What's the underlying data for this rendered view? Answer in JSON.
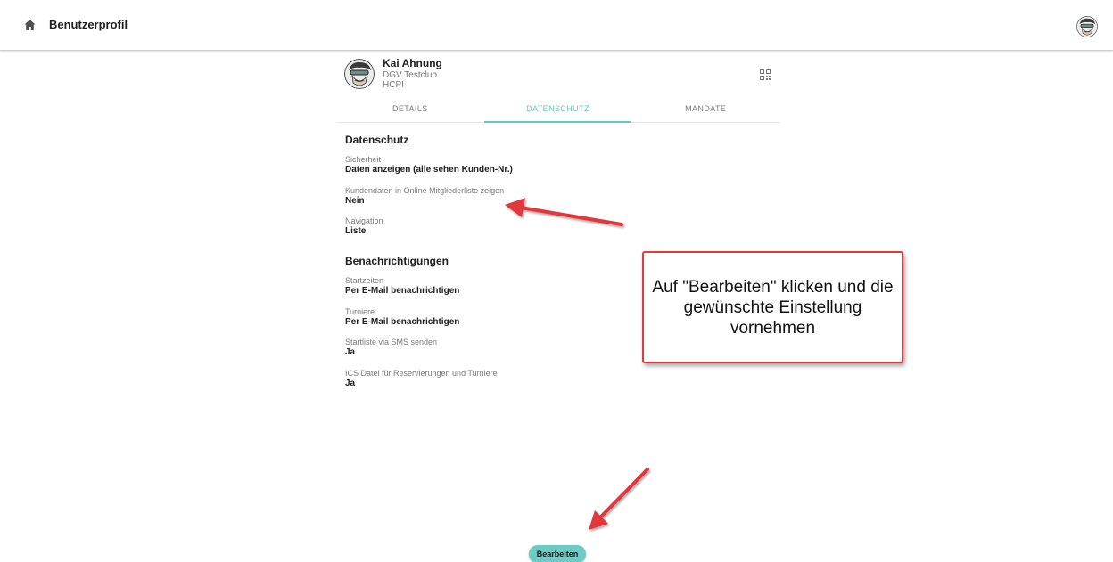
{
  "header": {
    "title": "Benutzerprofil"
  },
  "profile": {
    "name": "Kai Ahnung",
    "club": "DGV Testclub",
    "hcpi": "HCPI"
  },
  "tabs": [
    {
      "label": "DETAILS",
      "active": false
    },
    {
      "label": "DATENSCHUTZ",
      "active": true
    },
    {
      "label": "MANDATE",
      "active": false
    }
  ],
  "privacy": {
    "title": "Datenschutz",
    "fields": [
      {
        "label": "Sicherheit",
        "value": "Daten anzeigen (alle sehen Kunden-Nr.)"
      },
      {
        "label": "Kundendaten in Online Mitgliederliste zeigen",
        "value": "Nein"
      },
      {
        "label": "Navigation",
        "value": "Liste"
      }
    ]
  },
  "notifications": {
    "title": "Benachrichtigungen",
    "fields": [
      {
        "label": "Startzeiten",
        "value": "Per E-Mail benachrichtigen"
      },
      {
        "label": "Turniere",
        "value": "Per E-Mail benachrichtigen"
      },
      {
        "label": "Startliste via SMS senden",
        "value": "Ja"
      },
      {
        "label": "ICS Datei für Reservierungen und Turniere",
        "value": "Ja"
      }
    ]
  },
  "annotation": {
    "text": "Auf \"Bearbeiten\" klicken und die gewünschte Einstellung vornehmen"
  },
  "actions": {
    "edit_label": "Bearbeiten"
  },
  "colors": {
    "accent": "#62c8c0",
    "button": "#6ccbc3",
    "annotation_red": "#e2393c"
  },
  "icons": {
    "home": "home-icon",
    "qr": "qr-code-icon",
    "avatar": "avatar-icon",
    "arrow": "arrow-icon"
  }
}
